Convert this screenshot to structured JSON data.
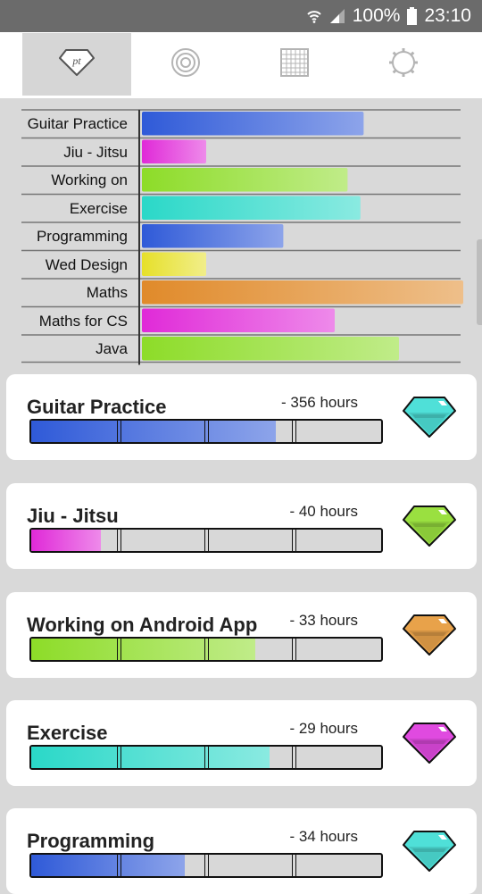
{
  "status_bar": {
    "battery": "100%",
    "time": "23:10",
    "icons": [
      "wifi-icon",
      "signal-icon",
      "battery-icon"
    ]
  },
  "nav": {
    "tabs": [
      {
        "icon": "logo-gem-icon",
        "label": "pt",
        "active": true
      },
      {
        "icon": "target-icon",
        "active": false
      },
      {
        "icon": "calendar-grid-icon",
        "active": false
      },
      {
        "icon": "gear-icon",
        "active": false
      }
    ]
  },
  "chart_data": {
    "type": "bar",
    "orientation": "horizontal",
    "categories": [
      "Guitar Practice",
      "Jiu - Jitsu",
      "Working on",
      "Exercise",
      "Programming",
      "Wed Design",
      "Maths",
      "Maths for CS",
      "Java"
    ],
    "values_fraction_of_max": [
      0.69,
      0.2,
      0.64,
      0.68,
      0.44,
      0.2,
      1.0,
      0.6,
      0.8
    ],
    "colors": [
      "#2f5ad8",
      "#e02ad8",
      "#8ddc28",
      "#2ad8c8",
      "#2f5ad8",
      "#e6e02a",
      "#e08a2a",
      "#e02ad8",
      "#8ddc28"
    ],
    "grid": true,
    "legend": "none"
  },
  "activities": [
    {
      "name": "Guitar Practice",
      "hours": "- 356 hours",
      "progress": 0.7,
      "color": "#2f5ad8",
      "gem_color": "#4fe0d8"
    },
    {
      "name": "Jiu - Jitsu",
      "hours": "- 40 hours",
      "progress": 0.2,
      "color": "#e02ad8",
      "gem_color": "#9ae040"
    },
    {
      "name": "Working on Android App",
      "hours": "- 33 hours",
      "progress": 0.64,
      "color": "#8ddc28",
      "gem_color": "#e8a24a"
    },
    {
      "name": "Exercise",
      "hours": "- 29 hours",
      "progress": 0.68,
      "color": "#2ad8c8",
      "gem_color": "#e04ae0"
    },
    {
      "name": "Programming",
      "hours": "- 34 hours",
      "progress": 0.44,
      "color": "#2f5ad8",
      "gem_color": "#4fe0d8"
    }
  ]
}
